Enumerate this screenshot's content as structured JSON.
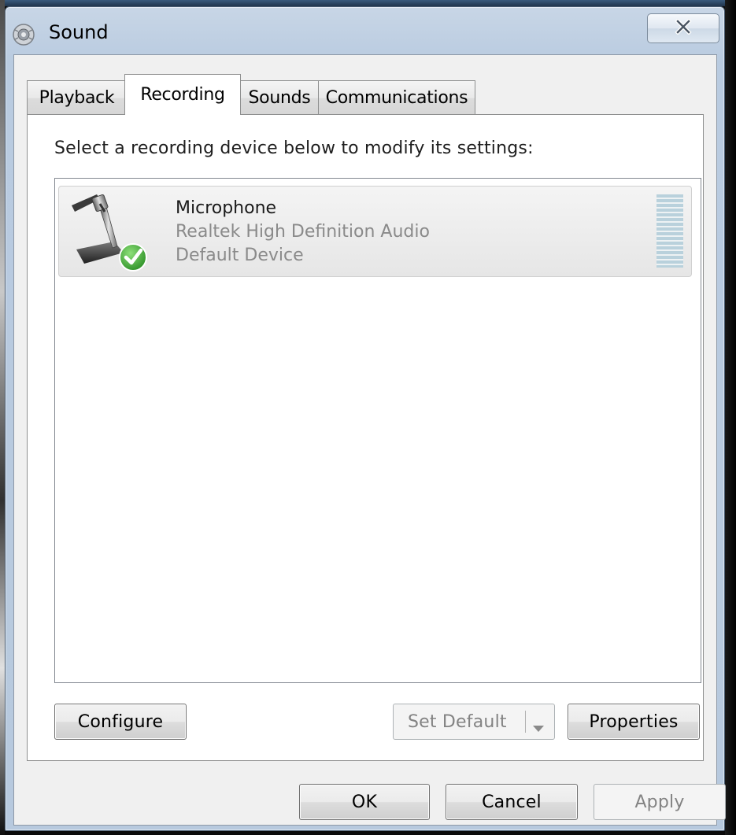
{
  "window": {
    "title": "Sound",
    "title_icon": "speaker-icon",
    "close_icon": "close-icon"
  },
  "tabs": [
    {
      "label": "Playback",
      "active": false
    },
    {
      "label": "Recording",
      "active": true
    },
    {
      "label": "Sounds",
      "active": false
    },
    {
      "label": "Communications",
      "active": false
    }
  ],
  "recording": {
    "instruction": "Select a recording device below to modify its settings:",
    "devices": [
      {
        "name": "Microphone",
        "driver": "Realtek High Definition Audio",
        "status": "Default Device",
        "icon": "microphone-icon",
        "badge_icon": "check-icon"
      }
    ]
  },
  "buttons": {
    "configure": "Configure",
    "set_default": "Set Default",
    "properties": "Properties",
    "ok": "OK",
    "cancel": "Cancel",
    "apply": "Apply"
  },
  "colors": {
    "window_frame": "#b9cbe0",
    "check_badge": "#36a534",
    "level_meter": "#b9d1dc"
  }
}
